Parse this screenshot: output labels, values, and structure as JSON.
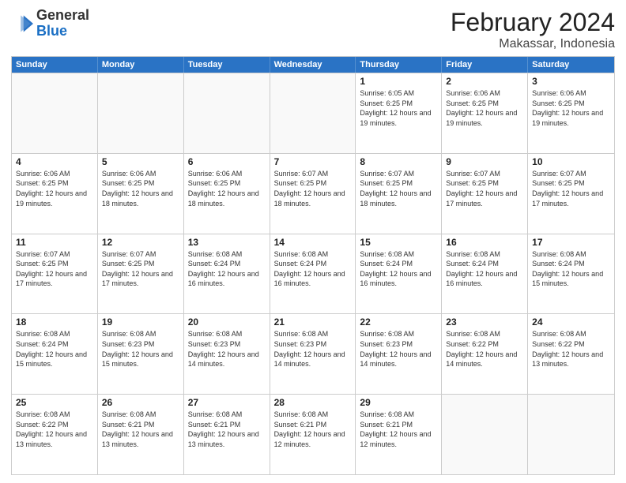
{
  "header": {
    "logo": {
      "general": "General",
      "blue": "Blue"
    },
    "title": "February 2024",
    "location": "Makassar, Indonesia"
  },
  "days": [
    "Sunday",
    "Monday",
    "Tuesday",
    "Wednesday",
    "Thursday",
    "Friday",
    "Saturday"
  ],
  "rows": [
    [
      {
        "day": "",
        "empty": true
      },
      {
        "day": "",
        "empty": true
      },
      {
        "day": "",
        "empty": true
      },
      {
        "day": "",
        "empty": true
      },
      {
        "day": "1",
        "sunrise": "6:05 AM",
        "sunset": "6:25 PM",
        "daylight": "12 hours and 19 minutes."
      },
      {
        "day": "2",
        "sunrise": "6:06 AM",
        "sunset": "6:25 PM",
        "daylight": "12 hours and 19 minutes."
      },
      {
        "day": "3",
        "sunrise": "6:06 AM",
        "sunset": "6:25 PM",
        "daylight": "12 hours and 19 minutes."
      }
    ],
    [
      {
        "day": "4",
        "sunrise": "6:06 AM",
        "sunset": "6:25 PM",
        "daylight": "12 hours and 19 minutes."
      },
      {
        "day": "5",
        "sunrise": "6:06 AM",
        "sunset": "6:25 PM",
        "daylight": "12 hours and 18 minutes."
      },
      {
        "day": "6",
        "sunrise": "6:06 AM",
        "sunset": "6:25 PM",
        "daylight": "12 hours and 18 minutes."
      },
      {
        "day": "7",
        "sunrise": "6:07 AM",
        "sunset": "6:25 PM",
        "daylight": "12 hours and 18 minutes."
      },
      {
        "day": "8",
        "sunrise": "6:07 AM",
        "sunset": "6:25 PM",
        "daylight": "12 hours and 18 minutes."
      },
      {
        "day": "9",
        "sunrise": "6:07 AM",
        "sunset": "6:25 PM",
        "daylight": "12 hours and 17 minutes."
      },
      {
        "day": "10",
        "sunrise": "6:07 AM",
        "sunset": "6:25 PM",
        "daylight": "12 hours and 17 minutes."
      }
    ],
    [
      {
        "day": "11",
        "sunrise": "6:07 AM",
        "sunset": "6:25 PM",
        "daylight": "12 hours and 17 minutes."
      },
      {
        "day": "12",
        "sunrise": "6:07 AM",
        "sunset": "6:25 PM",
        "daylight": "12 hours and 17 minutes."
      },
      {
        "day": "13",
        "sunrise": "6:08 AM",
        "sunset": "6:24 PM",
        "daylight": "12 hours and 16 minutes."
      },
      {
        "day": "14",
        "sunrise": "6:08 AM",
        "sunset": "6:24 PM",
        "daylight": "12 hours and 16 minutes."
      },
      {
        "day": "15",
        "sunrise": "6:08 AM",
        "sunset": "6:24 PM",
        "daylight": "12 hours and 16 minutes."
      },
      {
        "day": "16",
        "sunrise": "6:08 AM",
        "sunset": "6:24 PM",
        "daylight": "12 hours and 16 minutes."
      },
      {
        "day": "17",
        "sunrise": "6:08 AM",
        "sunset": "6:24 PM",
        "daylight": "12 hours and 15 minutes."
      }
    ],
    [
      {
        "day": "18",
        "sunrise": "6:08 AM",
        "sunset": "6:24 PM",
        "daylight": "12 hours and 15 minutes."
      },
      {
        "day": "19",
        "sunrise": "6:08 AM",
        "sunset": "6:23 PM",
        "daylight": "12 hours and 15 minutes."
      },
      {
        "day": "20",
        "sunrise": "6:08 AM",
        "sunset": "6:23 PM",
        "daylight": "12 hours and 14 minutes."
      },
      {
        "day": "21",
        "sunrise": "6:08 AM",
        "sunset": "6:23 PM",
        "daylight": "12 hours and 14 minutes."
      },
      {
        "day": "22",
        "sunrise": "6:08 AM",
        "sunset": "6:23 PM",
        "daylight": "12 hours and 14 minutes."
      },
      {
        "day": "23",
        "sunrise": "6:08 AM",
        "sunset": "6:22 PM",
        "daylight": "12 hours and 14 minutes."
      },
      {
        "day": "24",
        "sunrise": "6:08 AM",
        "sunset": "6:22 PM",
        "daylight": "12 hours and 13 minutes."
      }
    ],
    [
      {
        "day": "25",
        "sunrise": "6:08 AM",
        "sunset": "6:22 PM",
        "daylight": "12 hours and 13 minutes."
      },
      {
        "day": "26",
        "sunrise": "6:08 AM",
        "sunset": "6:21 PM",
        "daylight": "12 hours and 13 minutes."
      },
      {
        "day": "27",
        "sunrise": "6:08 AM",
        "sunset": "6:21 PM",
        "daylight": "12 hours and 13 minutes."
      },
      {
        "day": "28",
        "sunrise": "6:08 AM",
        "sunset": "6:21 PM",
        "daylight": "12 hours and 12 minutes."
      },
      {
        "day": "29",
        "sunrise": "6:08 AM",
        "sunset": "6:21 PM",
        "daylight": "12 hours and 12 minutes."
      },
      {
        "day": "",
        "empty": true
      },
      {
        "day": "",
        "empty": true
      }
    ]
  ]
}
